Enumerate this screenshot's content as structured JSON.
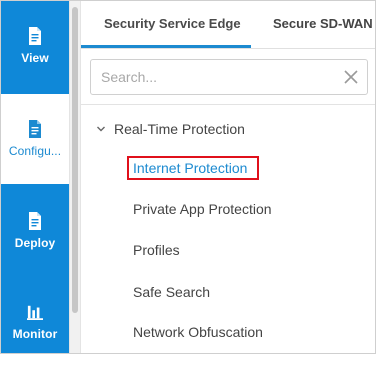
{
  "rail": {
    "items": [
      {
        "label": "View",
        "icon": "document-icon",
        "selected": false
      },
      {
        "label": "Configu...",
        "icon": "document-icon",
        "selected": true
      },
      {
        "label": "Deploy",
        "icon": "document-icon",
        "selected": false
      },
      {
        "label": "Monitor",
        "icon": "bar-chart-icon",
        "selected": false
      }
    ]
  },
  "tabs": [
    {
      "label": "Security Service Edge",
      "active": true
    },
    {
      "label": "Secure SD-WAN",
      "active": false
    }
  ],
  "search": {
    "placeholder": "Search...",
    "value": ""
  },
  "tree": {
    "group_label": "Real-Time Protection",
    "items": [
      {
        "label": "Internet Protection",
        "active": true
      },
      {
        "label": "Private App Protection",
        "active": false
      },
      {
        "label": "Profiles",
        "active": false
      },
      {
        "label": "Safe Search",
        "active": false
      },
      {
        "label": "Network Obfuscation",
        "active": false
      }
    ]
  },
  "colors": {
    "rail_blue": "#0f88d8",
    "accent": "#1c8ad0",
    "highlight_red": "#e0101b"
  }
}
